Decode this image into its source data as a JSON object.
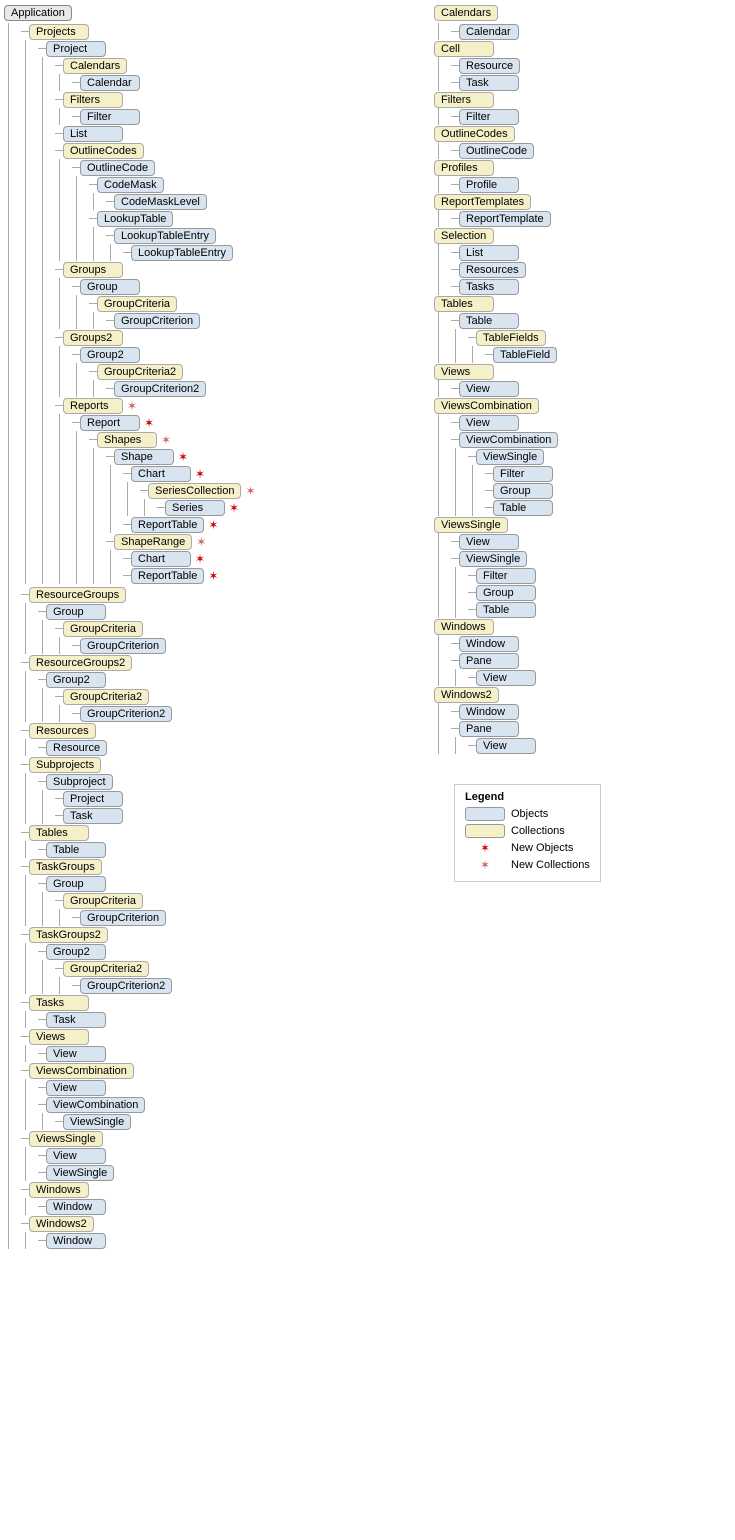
{
  "title": "Application",
  "left": {
    "root": "Application",
    "tree": [
      {
        "label": "Projects",
        "type": "collection",
        "indent": 0,
        "children": [
          {
            "label": "Project",
            "type": "object",
            "indent": 1,
            "children": [
              {
                "label": "Calendars",
                "type": "collection",
                "indent": 2,
                "children": [
                  {
                    "label": "Calendar",
                    "type": "object",
                    "indent": 3
                  }
                ]
              },
              {
                "label": "Filters",
                "type": "collection",
                "indent": 2,
                "children": [
                  {
                    "label": "Filter",
                    "type": "object",
                    "indent": 3
                  }
                ]
              },
              {
                "label": "List",
                "type": "object",
                "indent": 2
              },
              {
                "label": "OutlineCodes",
                "type": "collection",
                "indent": 2,
                "children": [
                  {
                    "label": "OutlineCode",
                    "type": "object",
                    "indent": 3,
                    "children": [
                      {
                        "label": "CodeMask",
                        "type": "object",
                        "indent": 4,
                        "children": [
                          {
                            "label": "CodeMaskLevel",
                            "type": "object",
                            "indent": 5
                          }
                        ]
                      },
                      {
                        "label": "LookupTable",
                        "type": "object",
                        "indent": 4,
                        "children": [
                          {
                            "label": "LookupTableEntry",
                            "type": "object",
                            "indent": 5,
                            "children": [
                              {
                                "label": "LookupTableEntry",
                                "type": "object",
                                "indent": 6
                              }
                            ]
                          }
                        ]
                      }
                    ]
                  }
                ]
              },
              {
                "label": "Groups",
                "type": "collection",
                "indent": 2,
                "children": [
                  {
                    "label": "Group",
                    "type": "object",
                    "indent": 3,
                    "children": [
                      {
                        "label": "GroupCriteria",
                        "type": "collection",
                        "indent": 4,
                        "children": [
                          {
                            "label": "GroupCriterion",
                            "type": "object",
                            "indent": 5
                          }
                        ]
                      }
                    ]
                  }
                ]
              },
              {
                "label": "Groups2",
                "type": "collection",
                "indent": 2,
                "children": [
                  {
                    "label": "Group2",
                    "type": "object",
                    "indent": 3,
                    "children": [
                      {
                        "label": "GroupCriteria2",
                        "type": "collection",
                        "indent": 4,
                        "children": [
                          {
                            "label": "GroupCriterion2",
                            "type": "object",
                            "indent": 5
                          }
                        ]
                      }
                    ]
                  }
                ]
              },
              {
                "label": "Reports",
                "type": "collection",
                "indent": 2,
                "star": "collection",
                "children": [
                  {
                    "label": "Report",
                    "type": "object",
                    "indent": 3,
                    "star": "object",
                    "children": [
                      {
                        "label": "Shapes",
                        "type": "collection",
                        "indent": 4,
                        "star": "collection",
                        "children": [
                          {
                            "label": "Shape",
                            "type": "object",
                            "indent": 5,
                            "star": "object",
                            "children": [
                              {
                                "label": "Chart",
                                "type": "object",
                                "indent": 6,
                                "star": "object",
                                "children": [
                                  {
                                    "label": "SeriesCollection",
                                    "type": "collection",
                                    "indent": 7,
                                    "star": "collection",
                                    "children": [
                                      {
                                        "label": "Series",
                                        "type": "object",
                                        "indent": 8,
                                        "star": "object"
                                      }
                                    ]
                                  }
                                ]
                              },
                              {
                                "label": "ReportTable",
                                "type": "object",
                                "indent": 6,
                                "star": "object"
                              }
                            ]
                          },
                          {
                            "label": "ShapeRange",
                            "type": "collection",
                            "indent": 5,
                            "star": "collection",
                            "children": [
                              {
                                "label": "Chart",
                                "type": "object",
                                "indent": 6,
                                "star": "object"
                              },
                              {
                                "label": "ReportTable",
                                "type": "object",
                                "indent": 6,
                                "star": "object"
                              }
                            ]
                          }
                        ]
                      }
                    ]
                  }
                ]
              }
            ]
          }
        ]
      },
      {
        "label": "ResourceGroups",
        "type": "collection",
        "indent": 0,
        "children": [
          {
            "label": "Group",
            "type": "object",
            "indent": 1,
            "children": [
              {
                "label": "GroupCriteria",
                "type": "collection",
                "indent": 2,
                "children": [
                  {
                    "label": "GroupCriterion",
                    "type": "object",
                    "indent": 3
                  }
                ]
              }
            ]
          }
        ]
      },
      {
        "label": "ResourceGroups2",
        "type": "collection",
        "indent": 0,
        "children": [
          {
            "label": "Group2",
            "type": "object",
            "indent": 1,
            "children": [
              {
                "label": "GroupCriteria2",
                "type": "collection",
                "indent": 2,
                "children": [
                  {
                    "label": "GroupCriterion2",
                    "type": "object",
                    "indent": 3
                  }
                ]
              }
            ]
          }
        ]
      },
      {
        "label": "Resources",
        "type": "collection",
        "indent": 0,
        "children": [
          {
            "label": "Resource",
            "type": "object",
            "indent": 1
          }
        ]
      },
      {
        "label": "Subprojects",
        "type": "collection",
        "indent": 0,
        "children": [
          {
            "label": "Subproject",
            "type": "object",
            "indent": 1,
            "children": [
              {
                "label": "Project",
                "type": "object",
                "indent": 2
              },
              {
                "label": "Task",
                "type": "object",
                "indent": 2
              }
            ]
          }
        ]
      },
      {
        "label": "Tables",
        "type": "collection",
        "indent": 0,
        "children": [
          {
            "label": "Table",
            "type": "object",
            "indent": 1
          }
        ]
      },
      {
        "label": "TaskGroups",
        "type": "collection",
        "indent": 0,
        "children": [
          {
            "label": "Group",
            "type": "object",
            "indent": 1,
            "children": [
              {
                "label": "GroupCriteria",
                "type": "collection",
                "indent": 2,
                "children": [
                  {
                    "label": "GroupCriterion",
                    "type": "object",
                    "indent": 3
                  }
                ]
              }
            ]
          }
        ]
      },
      {
        "label": "TaskGroups2",
        "type": "collection",
        "indent": 0,
        "children": [
          {
            "label": "Group2",
            "type": "object",
            "indent": 1,
            "children": [
              {
                "label": "GroupCriteria2",
                "type": "collection",
                "indent": 2,
                "children": [
                  {
                    "label": "GroupCriterion2",
                    "type": "object",
                    "indent": 3
                  }
                ]
              }
            ]
          }
        ]
      },
      {
        "label": "Tasks",
        "type": "collection",
        "indent": 0,
        "children": [
          {
            "label": "Task",
            "type": "object",
            "indent": 1
          }
        ]
      },
      {
        "label": "Views",
        "type": "collection",
        "indent": 0,
        "children": [
          {
            "label": "View",
            "type": "object",
            "indent": 1
          }
        ]
      },
      {
        "label": "ViewsCombination",
        "type": "collection",
        "indent": 0,
        "children": [
          {
            "label": "View",
            "type": "object",
            "indent": 1
          },
          {
            "label": "ViewCombination",
            "type": "object",
            "indent": 1,
            "children": [
              {
                "label": "ViewSingle",
                "type": "object",
                "indent": 2
              }
            ]
          }
        ]
      },
      {
        "label": "ViewsSingle",
        "type": "collection",
        "indent": 0,
        "children": [
          {
            "label": "View",
            "type": "object",
            "indent": 1
          },
          {
            "label": "ViewSingle",
            "type": "object",
            "indent": 1
          }
        ]
      },
      {
        "label": "Windows",
        "type": "collection",
        "indent": 0,
        "children": [
          {
            "label": "Window",
            "type": "object",
            "indent": 1
          }
        ]
      },
      {
        "label": "Windows2",
        "type": "collection",
        "indent": 0,
        "children": [
          {
            "label": "Window",
            "type": "object",
            "indent": 1
          }
        ]
      }
    ]
  },
  "right": {
    "tree": [
      {
        "label": "Calendars",
        "type": "collection",
        "children": [
          {
            "label": "Calendar",
            "type": "object"
          }
        ]
      },
      {
        "label": "Cell",
        "type": "collection",
        "children": [
          {
            "label": "Resource",
            "type": "object"
          },
          {
            "label": "Task",
            "type": "object"
          }
        ]
      },
      {
        "label": "Filters",
        "type": "collection",
        "children": [
          {
            "label": "Filter",
            "type": "object"
          }
        ]
      },
      {
        "label": "OutlineCodes",
        "type": "collection",
        "children": [
          {
            "label": "OutlineCode",
            "type": "object"
          }
        ]
      },
      {
        "label": "Profiles",
        "type": "collection",
        "children": [
          {
            "label": "Profile",
            "type": "object"
          }
        ]
      },
      {
        "label": "ReportTemplates",
        "type": "collection",
        "children": [
          {
            "label": "ReportTemplate",
            "type": "object"
          }
        ]
      },
      {
        "label": "Selection",
        "type": "collection",
        "children": [
          {
            "label": "List",
            "type": "object"
          },
          {
            "label": "Resources",
            "type": "object"
          },
          {
            "label": "Tasks",
            "type": "object"
          }
        ]
      },
      {
        "label": "Tables",
        "type": "collection",
        "children": [
          {
            "label": "Table",
            "type": "object",
            "children": [
              {
                "label": "TableFields",
                "type": "collection",
                "children": [
                  {
                    "label": "TableField",
                    "type": "object"
                  }
                ]
              }
            ]
          }
        ]
      },
      {
        "label": "Views",
        "type": "collection",
        "children": [
          {
            "label": "View",
            "type": "object"
          }
        ]
      },
      {
        "label": "ViewsCombination",
        "type": "collection",
        "children": [
          {
            "label": "View",
            "type": "object"
          },
          {
            "label": "ViewCombination",
            "type": "object",
            "children": [
              {
                "label": "ViewSingle",
                "type": "object",
                "children": [
                  {
                    "label": "Filter",
                    "type": "object"
                  },
                  {
                    "label": "Group",
                    "type": "object"
                  },
                  {
                    "label": "Table",
                    "type": "object"
                  }
                ]
              }
            ]
          }
        ]
      },
      {
        "label": "ViewsSingle",
        "type": "collection",
        "children": [
          {
            "label": "View",
            "type": "object"
          },
          {
            "label": "ViewSingle",
            "type": "object",
            "children": [
              {
                "label": "Filter",
                "type": "object"
              },
              {
                "label": "Group",
                "type": "object"
              },
              {
                "label": "Table",
                "type": "object"
              }
            ]
          }
        ]
      },
      {
        "label": "Windows",
        "type": "collection",
        "children": [
          {
            "label": "Window",
            "type": "object"
          },
          {
            "label": "Pane",
            "type": "object",
            "children": [
              {
                "label": "View",
                "type": "object"
              }
            ]
          }
        ]
      },
      {
        "label": "Windows2",
        "type": "collection",
        "children": [
          {
            "label": "Window",
            "type": "object"
          },
          {
            "label": "Pane",
            "type": "object",
            "children": [
              {
                "label": "View",
                "type": "object"
              }
            ]
          }
        ]
      }
    ]
  },
  "legend": {
    "title": "Legend",
    "items": [
      {
        "label": "Objects",
        "type": "object"
      },
      {
        "label": "Collections",
        "type": "collection"
      },
      {
        "label": "New Objects",
        "type": "new-object"
      },
      {
        "label": "New Collections",
        "type": "new-collection"
      }
    ]
  }
}
